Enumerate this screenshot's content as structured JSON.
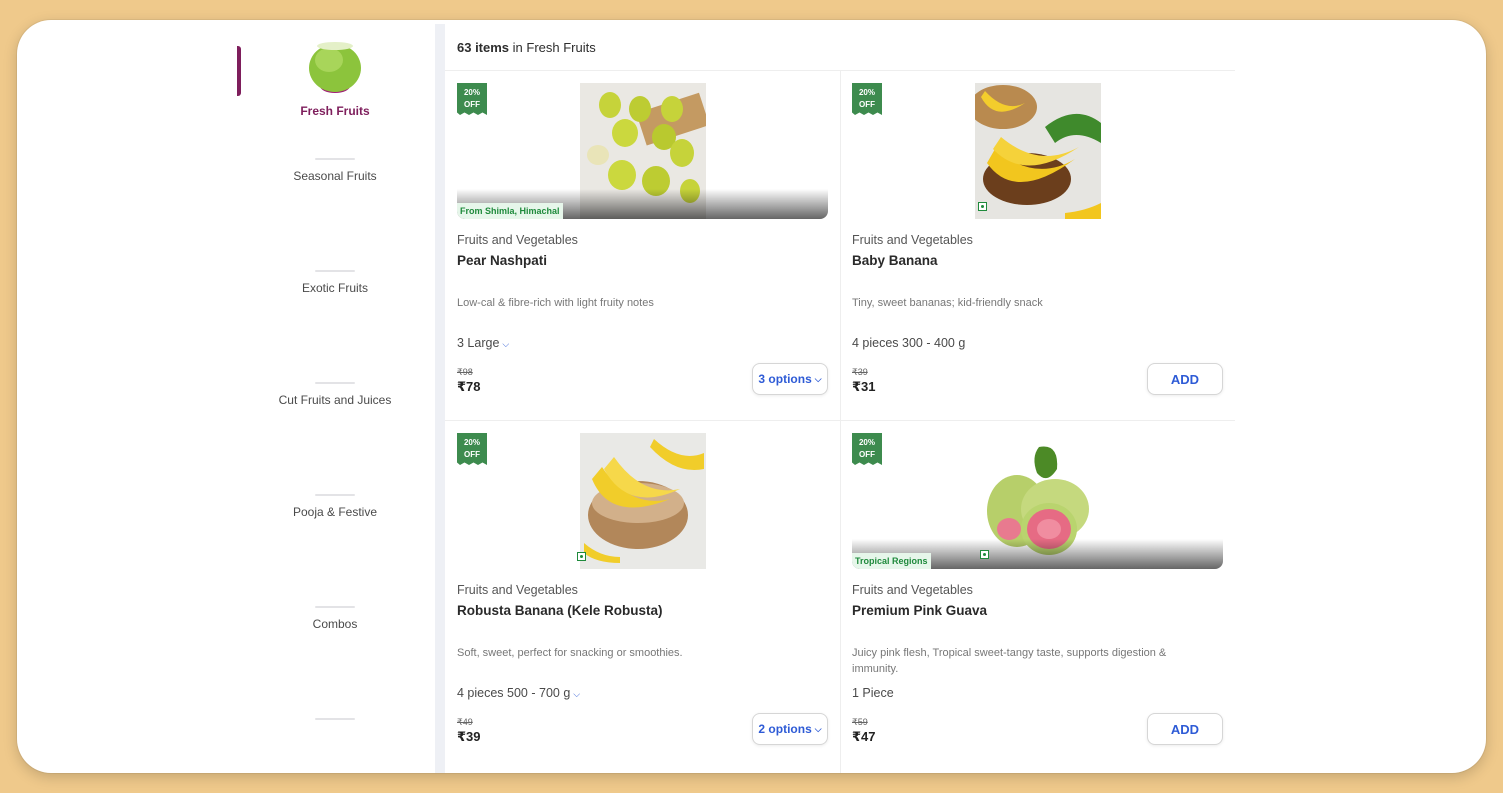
{
  "header": {
    "count_bold": "63 items",
    "count_rest": " in Fresh Fruits"
  },
  "sidebar": {
    "items": [
      {
        "label": "Fresh Fruits",
        "icon": "coconut-icon",
        "active": true
      },
      {
        "label": "Seasonal Fruits",
        "icon": "seasonal-fruits-icon"
      },
      {
        "label": "Exotic Fruits",
        "icon": "exotic-fruits-icon"
      },
      {
        "label": "Cut Fruits and Juices",
        "icon": "juice-icon"
      },
      {
        "label": "Pooja & Festive",
        "icon": "festive-flowers-icon"
      },
      {
        "label": "Combos",
        "icon": "combo-fruits-icon"
      },
      {
        "label": "",
        "icon": "grocery-bag-icon"
      }
    ]
  },
  "products": [
    {
      "badge_line1": "20%",
      "badge_line2": "OFF",
      "origin": "From Shimla, Himachal",
      "category": "Fruits and Vegetables",
      "name": "Pear Nashpati",
      "description": "Low-cal & fibre-rich with light fruity notes",
      "quantity": "3 Large",
      "mrp": "₹98",
      "price": "₹78",
      "action": "3 options",
      "image_icon": "pear-image"
    },
    {
      "badge_line1": "20%",
      "badge_line2": "OFF",
      "origin": "",
      "category": "Fruits and Vegetables",
      "name": "Baby Banana",
      "description": "Tiny, sweet bananas; kid-friendly snack",
      "quantity": "4 pieces 300 - 400 g",
      "mrp": "₹39",
      "price": "₹31",
      "action": "ADD",
      "image_icon": "baby-banana-image"
    },
    {
      "badge_line1": "20%",
      "badge_line2": "OFF",
      "origin": "",
      "category": "Fruits and Vegetables",
      "name": "Robusta Banana (Kele Robusta)",
      "description": "Soft, sweet, perfect for snacking or smoothies.",
      "quantity": "4 pieces 500 - 700 g",
      "mrp": "₹49",
      "price": "₹39",
      "action": "2 options",
      "image_icon": "robusta-banana-image"
    },
    {
      "badge_line1": "20%",
      "badge_line2": "OFF",
      "origin": "Tropical Regions",
      "category": "Fruits and Vegetables",
      "name": "Premium Pink Guava",
      "description": "Juicy pink flesh, Tropical sweet-tangy taste, supports digestion & immunity.",
      "quantity": "1 Piece",
      "mrp": "₹59",
      "price": "₹47",
      "action": "ADD",
      "image_icon": "pink-guava-image"
    }
  ],
  "colors": {
    "brand": "#7e1e5c",
    "badge": "#3d8b4e",
    "action": "#2e5bd6",
    "backdrop": "#efc98b"
  }
}
